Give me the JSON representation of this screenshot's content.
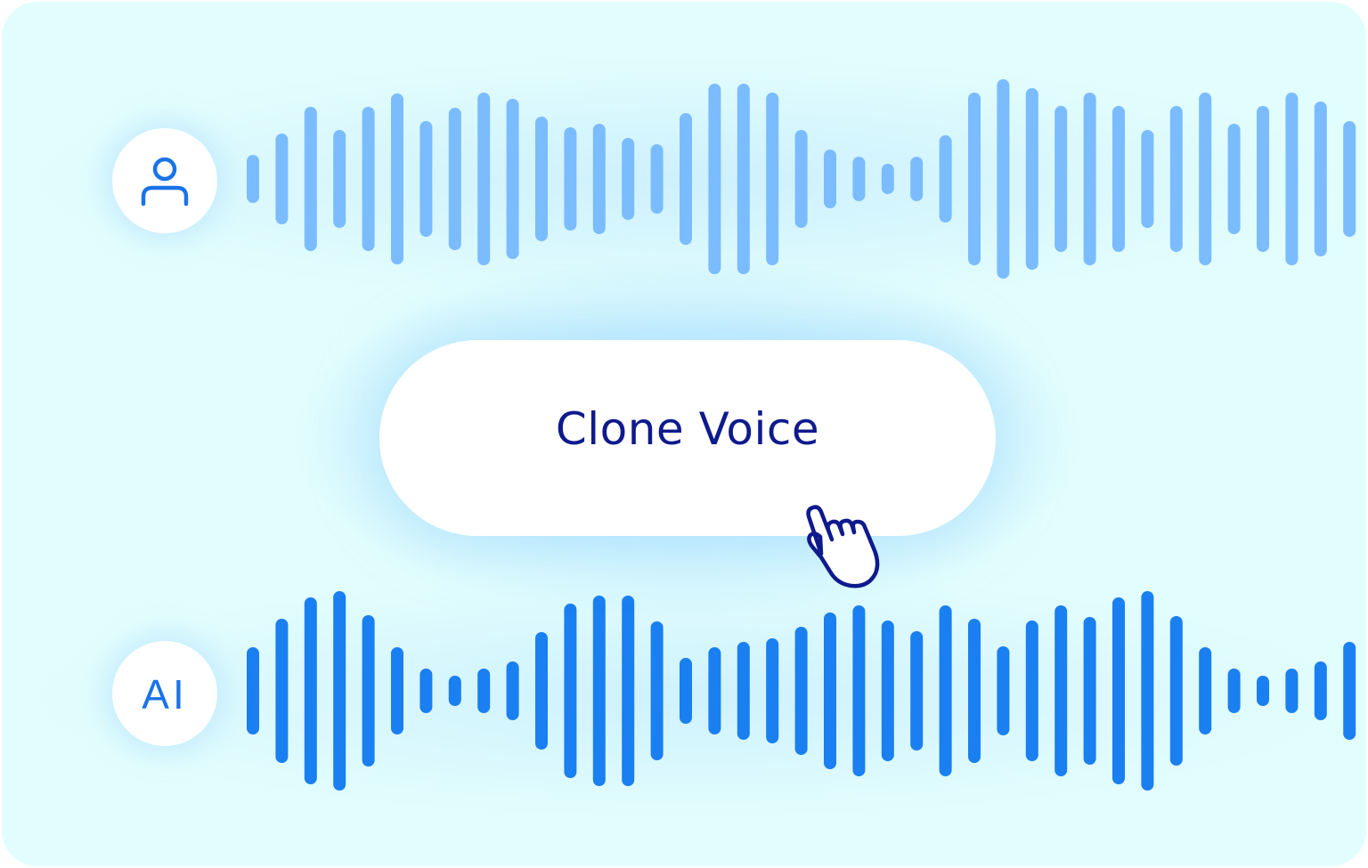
{
  "button": {
    "label": "Clone Voice"
  },
  "ai_avatar": {
    "label": "AI"
  },
  "icons": {
    "user": "user-icon",
    "pointer": "hand-pointer-icon"
  },
  "colors": {
    "background": "#e2fdfd",
    "user_wave": "#7bbcff",
    "ai_wave": "#1a7ff0",
    "button_text": "#0e1a8c",
    "cursor": "#0e1a8c"
  }
}
